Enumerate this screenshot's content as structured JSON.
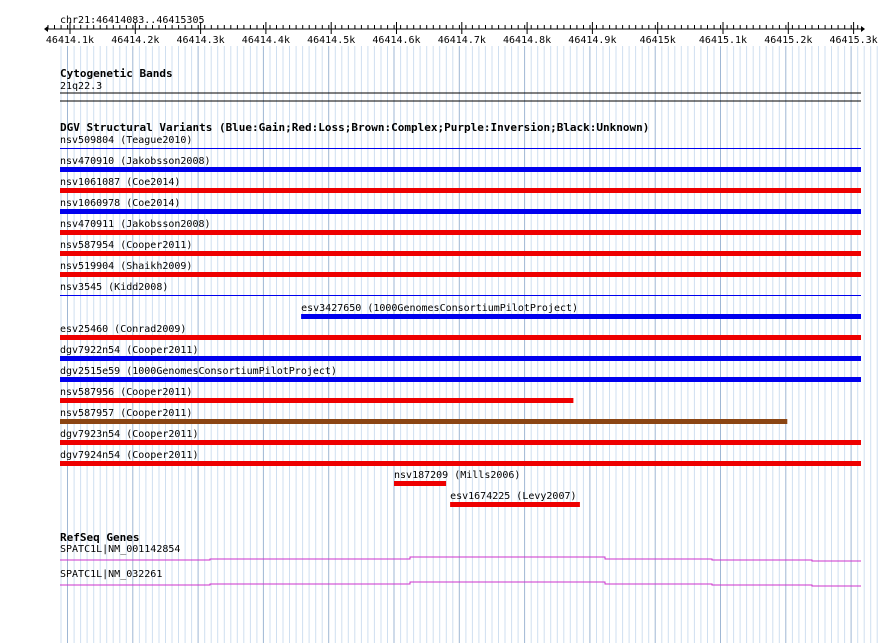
{
  "locus": "chr21:46414083..46415305",
  "ruler": {
    "labels": [
      "46414.1k",
      "46414.2k",
      "46414.3k",
      "46414.4k",
      "46414.5k",
      "46414.6k",
      "46414.7k",
      "46414.8k",
      "46414.9k",
      "46415k",
      "46415.1k",
      "46415.2k",
      "46415.3k"
    ]
  },
  "cytoband": {
    "title": "Cytogenetic Bands",
    "band": "21q22.3"
  },
  "dgv": {
    "title": "DGV Structural Variants (Blue:Gain;Red:Loss;Brown:Complex;Purple:Inversion;Black:Unknown)",
    "colors": {
      "gain": "#0000ee",
      "loss": "#ee0000",
      "complex": "#8b4513"
    },
    "features": [
      {
        "label": "nsv509804 (Teague2010)",
        "type": "gain",
        "start": 0.0,
        "end": 1.0,
        "thin": true
      },
      {
        "label": "nsv470910 (Jakobsson2008)",
        "type": "gain",
        "start": 0.0,
        "end": 1.0
      },
      {
        "label": "nsv1061087 (Coe2014)",
        "type": "loss",
        "start": 0.0,
        "end": 1.0
      },
      {
        "label": "nsv1060978 (Coe2014)",
        "type": "gain",
        "start": 0.0,
        "end": 1.0
      },
      {
        "label": "nsv470911 (Jakobsson2008)",
        "type": "loss",
        "start": 0.0,
        "end": 1.0
      },
      {
        "label": "nsv587954 (Cooper2011)",
        "type": "loss",
        "start": 0.0,
        "end": 1.0
      },
      {
        "label": "nsv519904 (Shaikh2009)",
        "type": "loss",
        "start": 0.0,
        "end": 1.0
      },
      {
        "label": "nsv3545 (Kidd2008)",
        "type": "gain",
        "start": 0.0,
        "end": 1.0,
        "thin": true
      },
      {
        "label": "esv3427650 (1000GenomesConsortiumPilotProject)",
        "type": "gain",
        "start": 0.301,
        "end": 1.0
      },
      {
        "label": "esv25460 (Conrad2009)",
        "type": "loss",
        "start": 0.0,
        "end": 1.0
      },
      {
        "label": "dgv7922n54 (Cooper2011)",
        "type": "gain",
        "start": 0.0,
        "end": 1.0
      },
      {
        "label": "dgv2515e59 (1000GenomesConsortiumPilotProject)",
        "type": "gain",
        "start": 0.0,
        "end": 1.0
      },
      {
        "label": "nsv587956 (Cooper2011)",
        "type": "loss",
        "start": 0.0,
        "end": 0.641
      },
      {
        "label": "nsv587957 (Cooper2011)",
        "type": "complex",
        "start": 0.0,
        "end": 0.908
      },
      {
        "label": "dgv7923n54 (Cooper2011)",
        "type": "loss",
        "start": 0.0,
        "end": 1.0
      },
      {
        "label": "dgv7924n54 (Cooper2011)",
        "type": "loss",
        "start": 0.0,
        "end": 1.0
      },
      {
        "label": "nsv187209 (Mills2006)",
        "type": "loss",
        "start": 0.417,
        "end": 0.482
      },
      {
        "label": "esv1674225 (Levy2007)",
        "type": "loss",
        "start": 0.487,
        "end": 0.649
      }
    ]
  },
  "refseq": {
    "title": "RefSeq Genes",
    "color": "#cc33cc",
    "genes": [
      {
        "label": "SPATC1L|NM_001142854"
      },
      {
        "label": "SPATC1L|NM_032261"
      }
    ]
  }
}
